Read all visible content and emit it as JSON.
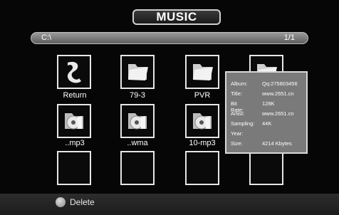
{
  "header": {
    "title": "MUSIC"
  },
  "pathbar": {
    "path": "C:\\",
    "page": "1/1"
  },
  "tiles": [
    {
      "label": "Return",
      "icon": "return-arrow-icon"
    },
    {
      "label": "79-3",
      "icon": "folder-icon"
    },
    {
      "label": "PVR",
      "icon": "folder-icon"
    },
    {
      "label": "",
      "icon": "folder-icon"
    },
    {
      "label": "..mp3",
      "icon": "music-disc-icon"
    },
    {
      "label": "..wma",
      "icon": "music-disc-icon"
    },
    {
      "label": "10-mp3",
      "icon": "music-disc-icon"
    },
    {
      "label": "",
      "icon": ""
    },
    {
      "label": "",
      "icon": ""
    },
    {
      "label": "",
      "icon": ""
    },
    {
      "label": "",
      "icon": ""
    },
    {
      "label": "",
      "icon": ""
    }
  ],
  "info": {
    "album_label": "Album:",
    "album": "Qq:275803456",
    "title_label": "Title:",
    "title": "www.2651.cn",
    "bitrate_label": "Bit Rate:",
    "bitrate": "128K",
    "artist_label": "Artist:",
    "artist": "www.2651.cn",
    "sampling_label": "Sampling:",
    "sampling": "44K",
    "year_label": "Year:",
    "year": "",
    "size_label": "Size:",
    "size": "4214 Kbytes"
  },
  "footer": {
    "delete_label": "Delete"
  }
}
